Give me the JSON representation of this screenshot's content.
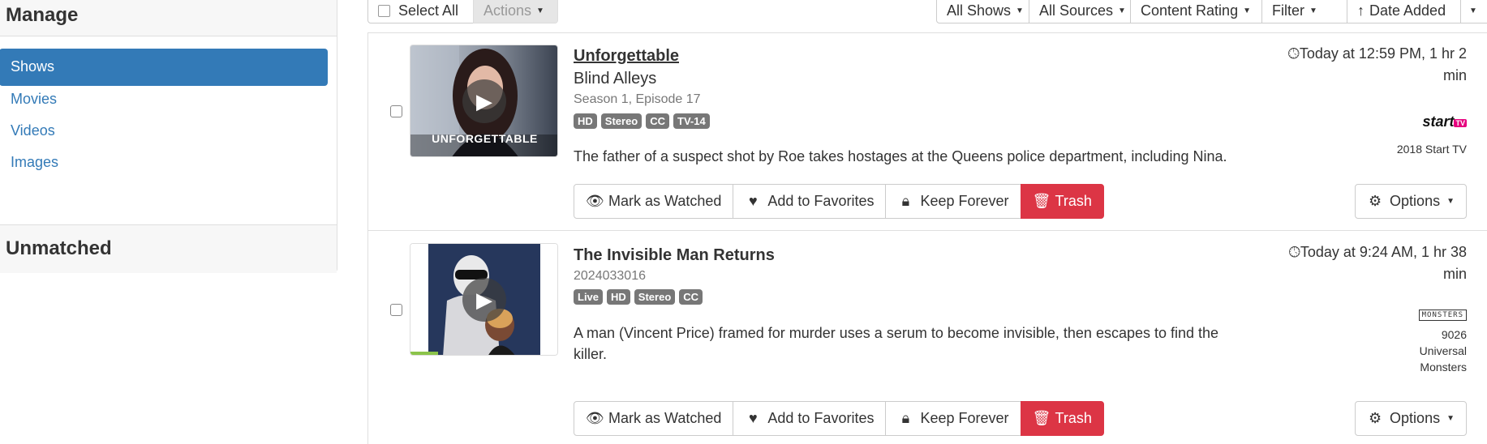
{
  "sidebar": {
    "header": "Manage",
    "items": [
      {
        "label": "Shows",
        "active": true
      },
      {
        "label": "Movies",
        "active": false
      },
      {
        "label": "Videos",
        "active": false
      },
      {
        "label": "Images",
        "active": false
      }
    ],
    "footer": "Unmatched"
  },
  "toolbar": {
    "select_all": "Select All",
    "actions": "Actions",
    "all_shows": "All Shows",
    "all_sources": "All Sources",
    "content_rating": "Content Rating",
    "filter": "Filter",
    "date_added": "Date Added"
  },
  "recordings": [
    {
      "title": "Unforgettable",
      "episode_title": "Blind Alleys",
      "meta": "Season 1, Episode 17",
      "thumb_caption": "UNFORGETTABLE",
      "badges": [
        "HD",
        "Stereo",
        "CC",
        "TV-14"
      ],
      "description": "The father of a suspect shot by Roe takes hostages at the Queens police department, including Nina.",
      "when": "Today at 12:59 PM, 1 hr 2 min",
      "channel_logo": "start",
      "channel_logo_suffix": "TV",
      "channel": "2018 Start TV",
      "watched_fraction": 0
    },
    {
      "title": "The Invisible Man Returns",
      "episode_title": "",
      "meta": "2024033016",
      "thumb_caption": "",
      "badges": [
        "Live",
        "HD",
        "Stereo",
        "CC"
      ],
      "description": "A man (Vincent Price) framed for murder uses a serum to become invisible, then escapes to find the killer.",
      "when": "Today at 9:24 AM, 1 hr 38 min",
      "channel_logo": "MONSTERS",
      "channel_logo_suffix": "",
      "channel": "9026 Universal Monsters",
      "watched_fraction": 0.19
    }
  ],
  "actions": {
    "mark_watched": "Mark as Watched",
    "add_favorites": "Add to Favorites",
    "keep_forever": "Keep Forever",
    "trash": "Trash",
    "options": "Options"
  },
  "colors": {
    "accent": "#337ab7",
    "danger": "#dc3545",
    "badge": "#777777",
    "progress": "#8bc34a",
    "start_tv_pink": "#e6007e"
  }
}
